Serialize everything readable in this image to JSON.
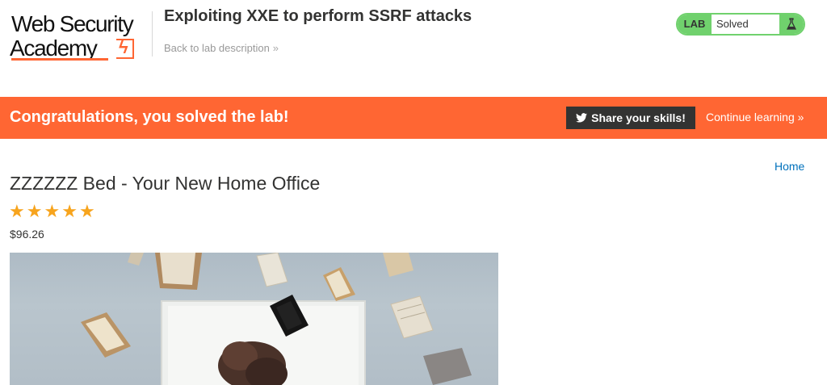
{
  "header": {
    "logo_line1": "Web Security",
    "logo_line2": "Academy",
    "lab_title": "Exploiting XXE to perform SSRF attacks",
    "back_link": "Back to lab description",
    "back_chevron": "»"
  },
  "status": {
    "tag": "LAB",
    "text": "Solved",
    "icon": "flask-icon",
    "color": "#70d16d"
  },
  "banner": {
    "message": "Congratulations, you solved the lab!",
    "share_label": "Share your skills!",
    "share_icon": "twitter-icon",
    "continue_label": "Continue learning",
    "continue_chevron": "»",
    "color": "#ff6633"
  },
  "nav": {
    "home": "Home"
  },
  "product": {
    "title": "ZZZZZZ Bed - Your New Home Office",
    "rating_stars": 5,
    "price": "$96.26",
    "image_alt": "Bed with flying books"
  }
}
